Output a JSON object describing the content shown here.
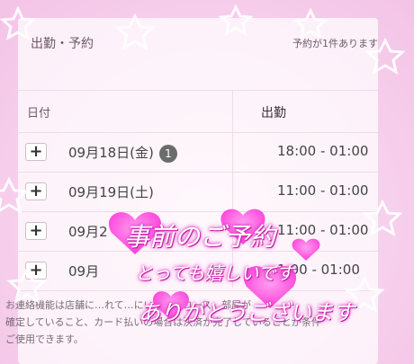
{
  "header": {
    "title": "出勤・予約",
    "reservation_status": "予約が1件あります"
  },
  "table": {
    "col_date": "日付",
    "col_shift": "出勤",
    "rows": [
      {
        "date": "09月18日(金)",
        "badge": "1",
        "time": "18:00 - 01:00"
      },
      {
        "date": "09月19日(土)",
        "time": "11:00 - 01:00"
      },
      {
        "date": "09月2",
        "time": "11:00 - 01:00"
      },
      {
        "date": "09月",
        "time": "1:00 - 01:00"
      }
    ]
  },
  "footer": {
    "line1": "お連絡機能は店舗に…れて…にいます。コース、部屋が",
    "line2": "確定していること、カード払いの場合は決済が完了していることが条件",
    "line3": "ご使用できます。"
  },
  "overlay": {
    "line1": "事前のご予約",
    "line2": "とっても嬉しいです",
    "line3": "ありがとうございます"
  },
  "colors": {
    "accent_pink": "#e23dc7",
    "heart": "#ff3fe0"
  }
}
